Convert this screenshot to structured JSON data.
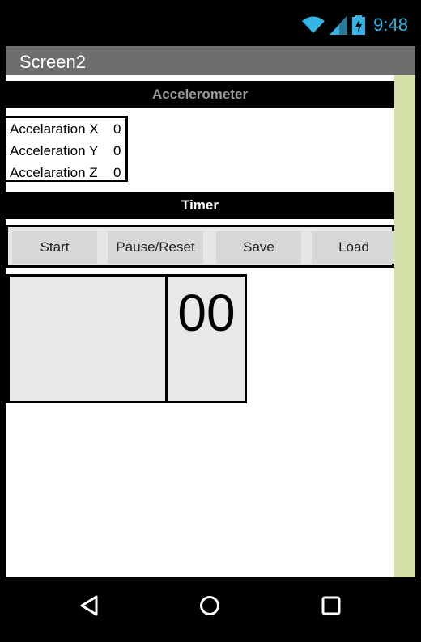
{
  "status_bar": {
    "time": "9:48",
    "wifi_icon": "wifi-icon",
    "signal_icon": "signal-icon",
    "battery_icon": "battery-charging-icon"
  },
  "title_bar": {
    "title": "Screen2"
  },
  "accelerometer": {
    "header": "Accelerometer",
    "rows": [
      {
        "label": "Accelaration X",
        "value": "0"
      },
      {
        "label": "Acceleration Y",
        "value": "0"
      },
      {
        "label": "Accelaration Z",
        "value": "0"
      }
    ]
  },
  "timer": {
    "header": "Timer",
    "buttons": {
      "start": "Start",
      "pause_reset": "Pause/Reset",
      "save": "Save",
      "load": "Load"
    },
    "counter": "00"
  },
  "nav_bar": {
    "back": "back-icon",
    "home": "home-icon",
    "recents": "recents-icon"
  }
}
